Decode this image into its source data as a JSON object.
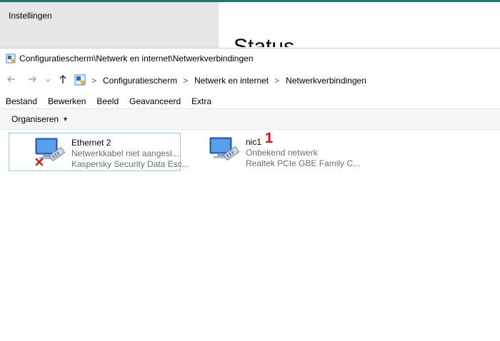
{
  "settings_window": {
    "title": "Instellingen",
    "heading": "Status"
  },
  "explorer": {
    "window_title": "Configuratiescherm\\Netwerk en internet\\Netwerkverbindingen",
    "nav": {
      "back_icon": "arrow-left-icon",
      "forward_icon": "arrow-right-icon",
      "recent_icon": "chevron-down-icon",
      "up_icon": "arrow-up-icon"
    },
    "breadcrumb": [
      "Configuratiescherm",
      "Netwerk en internet",
      "Netwerkverbindingen"
    ],
    "breadcrumb_separator": ">",
    "menu": [
      "Bestand",
      "Bewerken",
      "Beeld",
      "Geavanceerd",
      "Extra"
    ],
    "command_bar": {
      "organize_label": "Organiseren",
      "caret": "▼"
    },
    "connections": [
      {
        "name": "Ethernet 2",
        "status": "Netwerkkabel niet aangesl...",
        "device": "Kaspersky Security Data Esc...",
        "disconnected": true,
        "selected": true
      },
      {
        "name": "nic1",
        "status": "Onbekend netwerk",
        "device": "Realtek PCIe GBE Family C...",
        "disconnected": false,
        "selected": false
      }
    ],
    "annotation": "1"
  },
  "colors": {
    "accent_teal": "#1f7a6e",
    "selection_border": "#99c9ef",
    "disconnected_x": "#d11a1a",
    "annotation_red": "#e0001b",
    "secondary_text": "#6d6d6d"
  }
}
